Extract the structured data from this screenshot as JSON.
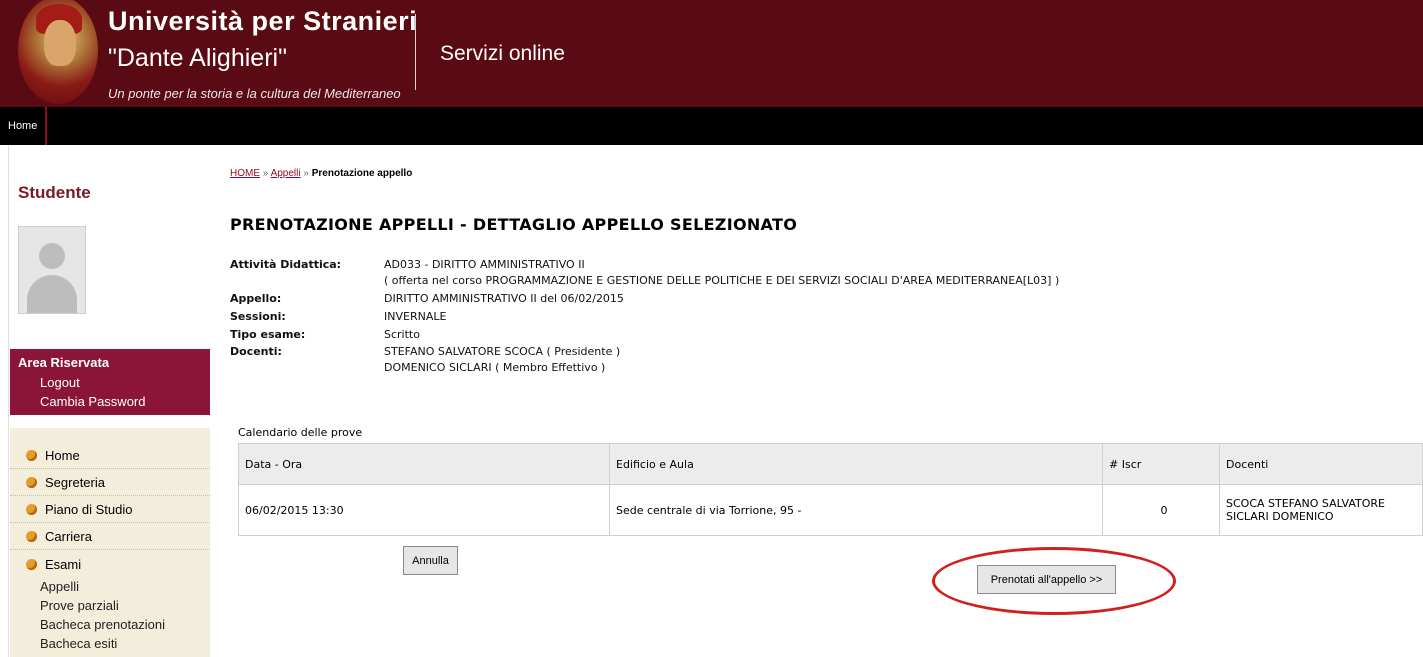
{
  "header": {
    "university_title": "Università per Stranieri",
    "university_subtitle": "\"Dante Alighieri\"",
    "motto": "Un ponte per la storia e la cultura del Mediterraneo",
    "services": "Servizi online"
  },
  "navbar": {
    "home": "Home"
  },
  "sidebar": {
    "studente": "Studente",
    "area": {
      "title": "Area Riservata",
      "logout": "Logout",
      "password": "Cambia Password"
    },
    "menu": [
      "Home",
      "Segreteria",
      "Piano di Studio",
      "Carriera",
      "Esami"
    ],
    "submenu": [
      "Appelli",
      "Prove parziali",
      "Bacheca prenotazioni",
      "Bacheca esiti"
    ]
  },
  "breadcrumb": {
    "home": "HOME",
    "appelli": "Appelli",
    "current": "Prenotazione appello",
    "sep": "»"
  },
  "page_title": "PRENOTAZIONE APPELLI - DETTAGLIO APPELLO SELEZIONATO",
  "details": {
    "attivita_label": "Attività Didattica:",
    "attivita_value": "AD033 - DIRITTO AMMINISTRATIVO II",
    "offerta": "( offerta nel corso  PROGRAMMAZIONE E GESTIONE DELLE POLITICHE E DEI SERVIZI SOCIALI D'AREA MEDITERRANEA[L03] )",
    "appello_label": "Appello:",
    "appello_value": "DIRITTO AMMINISTRATIVO II del 06/02/2015",
    "sessioni_label": "Sessioni:",
    "sessioni_value": "INVERNALE",
    "tipo_label": "Tipo esame:",
    "tipo_value": "Scritto",
    "docenti_label": "Docenti:",
    "docente1": "STEFANO SALVATORE SCOCA ( Presidente )",
    "docente2": "DOMENICO SICLARI ( Membro Effettivo )"
  },
  "calendar": {
    "caption": "Calendario delle prove",
    "headers": [
      "Data - Ora",
      "Edificio e Aula",
      "# Iscr",
      "Docenti"
    ],
    "row": {
      "data": "06/02/2015  13:30",
      "edificio": "Sede centrale di via Torrione, 95 -",
      "iscr": "0",
      "docente1": "SCOCA STEFANO SALVATORE",
      "docente2": "SICLARI DOMENICO"
    }
  },
  "buttons": {
    "annulla": "Annulla",
    "prenotati": "Prenotati all'appello >>"
  },
  "colors": {
    "header_bg": "#5a0a12",
    "area_bg": "#8a1538",
    "menu_bg": "#f2eedb",
    "highlight": "#d0201c"
  }
}
